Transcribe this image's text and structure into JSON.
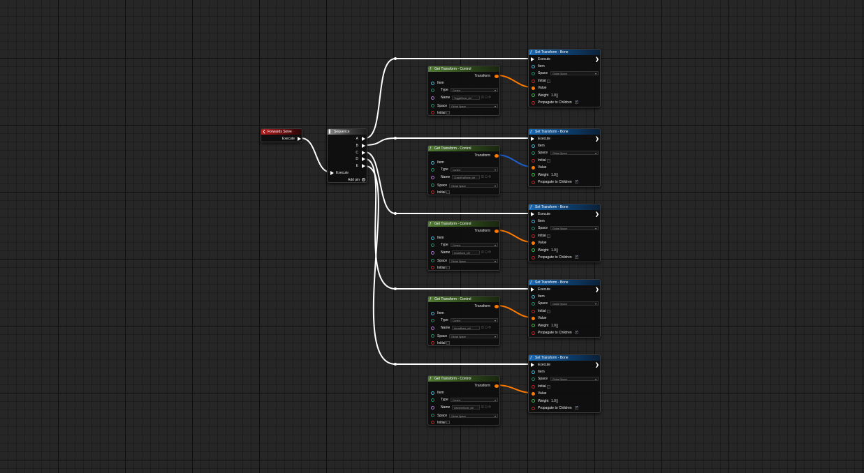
{
  "colors": {
    "exec": "#ffffff",
    "item_pin": "#3fb6e0",
    "type_pin": "#1e8f6f",
    "name_pin": "#b36ee0",
    "space_pin": "#1e8f6f",
    "bool_pin": "#cc1f1f",
    "weight_pin": "#34c23c",
    "transform_pin": "#ff7a00",
    "transform_wire_blue": "#1d5fc9"
  },
  "forwards_solve": {
    "title": "Forwards Solve",
    "execute_label": "Execute"
  },
  "sequence": {
    "title": "Sequence",
    "execute_label": "Execute",
    "add_pin_label": "Add pin",
    "outputs": [
      "A",
      "B",
      "C",
      "D",
      "E"
    ]
  },
  "get_nodes": [
    {
      "title": "Get Transform - Control",
      "transform_label": "Transform",
      "item_label": "Item",
      "type_label": "Type",
      "type_value": "Control",
      "name_label": "Name",
      "name_value": "ToggleBone_ctrl",
      "space_label": "Space",
      "space_value": "Global Space",
      "initial_label": "Initial"
    },
    {
      "title": "Get Transform - Control",
      "transform_label": "Transform",
      "item_label": "Item",
      "type_label": "Type",
      "type_value": "Control",
      "name_label": "Name",
      "name_value": "ChainEndBone_ctrl",
      "space_label": "Space",
      "space_value": "Global Space",
      "initial_label": "Initial"
    },
    {
      "title": "Get Transform - Control",
      "transform_label": "Transform",
      "item_label": "Item",
      "type_label": "Type",
      "type_value": "Control",
      "name_label": "Name",
      "name_value": "KnobBone_ctrl",
      "space_label": "Space",
      "space_value": "Global Space",
      "initial_label": "Initial"
    },
    {
      "title": "Get Transform - Control",
      "transform_label": "Transform",
      "item_label": "Item",
      "type_label": "Type",
      "type_value": "Control",
      "name_label": "Name",
      "name_value": "ArrowBone_ctrl",
      "space_label": "Space",
      "space_value": "Global Space",
      "initial_label": "Initial"
    },
    {
      "title": "Get Transform - Control",
      "transform_label": "Transform",
      "item_label": "Item",
      "type_label": "Type",
      "type_value": "Control",
      "name_label": "Name",
      "name_value": "HammerBone_ctrl",
      "space_label": "Space",
      "space_value": "Global Space",
      "initial_label": "Initial"
    }
  ],
  "set_nodes": [
    {
      "title": "Set Transform - Bone",
      "execute_label": "Execute",
      "item_label": "Item",
      "space_label": "Space",
      "space_value": "Global Space",
      "initial_label": "Initial",
      "value_label": "Value",
      "weight_label": "Weight",
      "weight_value": "1.0",
      "propagate_label": "Propagate to Children"
    },
    {
      "title": "Set Transform - Bone",
      "execute_label": "Execute",
      "item_label": "Item",
      "space_label": "Space",
      "space_value": "Global Space",
      "initial_label": "Initial",
      "value_label": "Value",
      "weight_label": "Weight",
      "weight_value": "1.0",
      "propagate_label": "Propagate to Children"
    },
    {
      "title": "Set Transform - Bone",
      "execute_label": "Execute",
      "item_label": "Item",
      "space_label": "Space",
      "space_value": "Global Space",
      "initial_label": "Initial",
      "value_label": "Value",
      "weight_label": "Weight",
      "weight_value": "1.0",
      "propagate_label": "Propagate to Children"
    },
    {
      "title": "Set Transform - Bone",
      "execute_label": "Execute",
      "item_label": "Item",
      "space_label": "Space",
      "space_value": "Global Space",
      "initial_label": "Initial",
      "value_label": "Value",
      "weight_label": "Weight",
      "weight_value": "1.0",
      "propagate_label": "Propagate to Children"
    },
    {
      "title": "Set Transform - Bone",
      "execute_label": "Execute",
      "item_label": "Item",
      "space_label": "Space",
      "space_value": "Global Space",
      "initial_label": "Initial",
      "value_label": "Value",
      "weight_label": "Weight",
      "weight_value": "1.0",
      "propagate_label": "Propagate to Children"
    }
  ]
}
